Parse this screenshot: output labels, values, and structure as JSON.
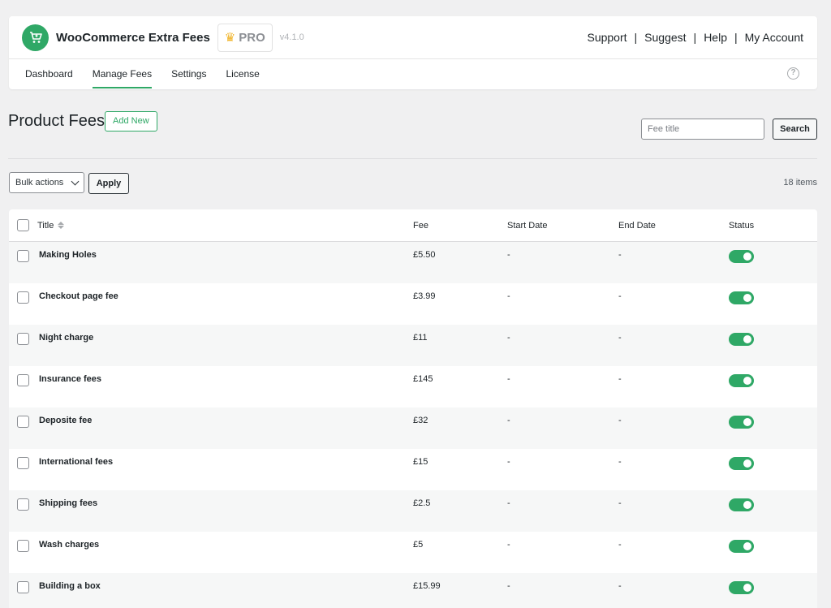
{
  "header": {
    "app_title": "WooCommerce Extra Fees",
    "pro_label": "PRO",
    "version": "v4.1.0",
    "links": [
      "Support",
      "Suggest",
      "Help",
      "My Account"
    ],
    "link_separator": "|",
    "help_symbol": "?",
    "brand_color": "#2fa866",
    "logo_icon": "shopping-cart-icon"
  },
  "nav": {
    "tabs": [
      "Dashboard",
      "Manage Fees",
      "Settings",
      "License"
    ],
    "active": "Manage Fees"
  },
  "page": {
    "title": "Product Fees",
    "add_new_label": "Add New",
    "search_placeholder": "Fee title",
    "search_button": "Search",
    "bulk_actions": "Bulk actions",
    "apply_label": "Apply",
    "items_count": "18 items"
  },
  "table": {
    "columns": [
      "Title",
      "Fee",
      "Start Date",
      "End Date",
      "Status"
    ],
    "rows": [
      {
        "title": "Making Holes",
        "fee": "£5.50",
        "start": "-",
        "end": "-",
        "status": "on"
      },
      {
        "title": "Checkout page fee",
        "fee": "£3.99",
        "start": "-",
        "end": "-",
        "status": "on"
      },
      {
        "title": "Night charge",
        "fee": "£11",
        "start": "-",
        "end": "-",
        "status": "on"
      },
      {
        "title": "Insurance fees",
        "fee": "£145",
        "start": "-",
        "end": "-",
        "status": "on"
      },
      {
        "title": "Deposite fee",
        "fee": "£32",
        "start": "-",
        "end": "-",
        "status": "on"
      },
      {
        "title": "International fees",
        "fee": "£15",
        "start": "-",
        "end": "-",
        "status": "on"
      },
      {
        "title": "Shipping fees",
        "fee": "£2.5",
        "start": "-",
        "end": "-",
        "status": "on"
      },
      {
        "title": "Wash charges",
        "fee": "£5",
        "start": "-",
        "end": "-",
        "status": "on"
      },
      {
        "title": "Building a box",
        "fee": "£15.99",
        "start": "-",
        "end": "-",
        "status": "on"
      }
    ]
  }
}
